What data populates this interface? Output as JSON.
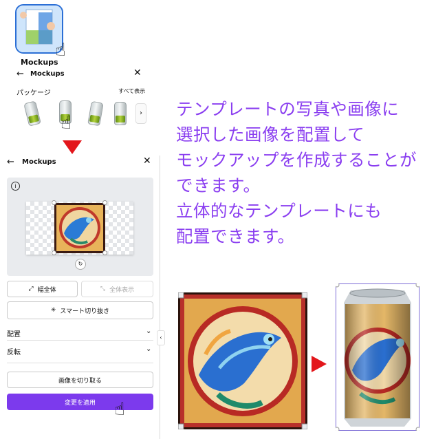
{
  "app": {
    "label": "Mockups",
    "accent": "#2b6fd6"
  },
  "top_panel": {
    "back_icon": "arrow-left-icon",
    "title": "Mockups",
    "close_icon": "close-icon",
    "section_label": "パッケージ",
    "see_all": "すべて表示",
    "next_icon": "chevron-right-icon"
  },
  "panel": {
    "back_icon": "arrow-left-icon",
    "title": "Mockups",
    "close_icon": "close-icon",
    "info_icon": "info-icon",
    "fit_width_label": "幅全体",
    "show_all_label": "全体表示",
    "smart_crop_label": "スマート切り抜き",
    "arrange_label": "配置",
    "flip_label": "反転",
    "crop_label": "画像を切り取る",
    "apply_label": "変更を適用",
    "apply_color": "#7c3aed"
  },
  "caption": {
    "lines": [
      "テンプレートの写真や画像に",
      "選択した画像を配置して",
      "モックアップを作成することが",
      "できます。",
      "立体的なテンプレートにも",
      "配置できます。"
    ],
    "color": "#8a3ef0"
  },
  "arrow_color": "#e3161b"
}
